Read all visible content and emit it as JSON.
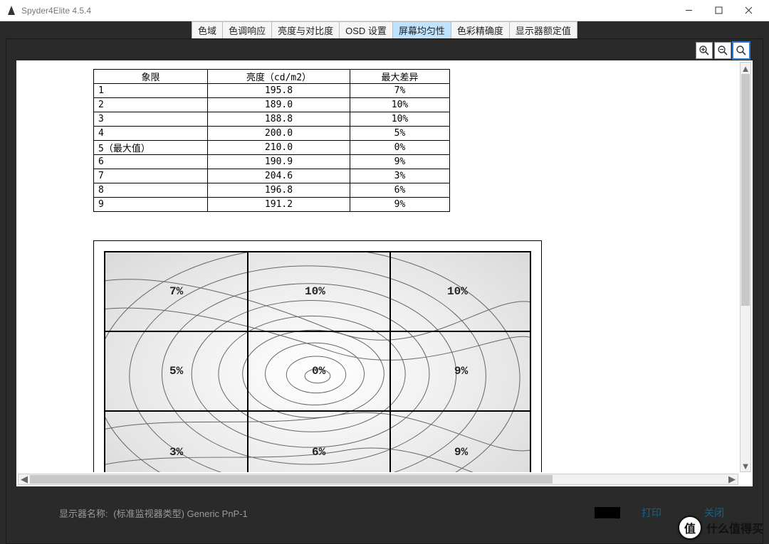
{
  "window": {
    "title": "Spyder4Elite 4.5.4"
  },
  "tabs": [
    {
      "id": "gamut",
      "label": "色域"
    },
    {
      "id": "tonal",
      "label": "色调响应"
    },
    {
      "id": "brightness",
      "label": "亮度与对比度"
    },
    {
      "id": "osd",
      "label": "OSD 设置"
    },
    {
      "id": "uniformity",
      "label": "屏幕均匀性"
    },
    {
      "id": "accuracy",
      "label": "色彩精确度"
    },
    {
      "id": "rated",
      "label": "显示器额定值"
    }
  ],
  "activeTab": "uniformity",
  "table": {
    "headers": {
      "quadrant": "象限",
      "luminance": "亮度（cd/m2）",
      "maxdiff": "最大差异"
    },
    "rows": [
      {
        "q": "1",
        "lum": "195.8",
        "diff": "7%"
      },
      {
        "q": "2",
        "lum": "189.0",
        "diff": "10%"
      },
      {
        "q": "3",
        "lum": "188.8",
        "diff": "10%"
      },
      {
        "q": "4",
        "lum": "200.0",
        "diff": "5%"
      },
      {
        "q": "5（最大值）",
        "lum": "210.0",
        "diff": "0%"
      },
      {
        "q": "6",
        "lum": "190.9",
        "diff": "9%"
      },
      {
        "q": "7",
        "lum": "204.6",
        "diff": "3%"
      },
      {
        "q": "8",
        "lum": "196.8",
        "diff": "6%"
      },
      {
        "q": "9",
        "lum": "191.2",
        "diff": "9%"
      }
    ]
  },
  "map": {
    "cells": [
      "7%",
      "10%",
      "10%",
      "5%",
      "0%",
      "9%",
      "3%",
      "6%",
      "9%"
    ]
  },
  "footer": {
    "labelPrefix": "显示器名称:",
    "labelValue": "(标准监视器类型) Generic PnP-1",
    "print": "打印",
    "close": "关闭"
  },
  "overlay": {
    "icon": "值",
    "text": "什么值得买"
  }
}
